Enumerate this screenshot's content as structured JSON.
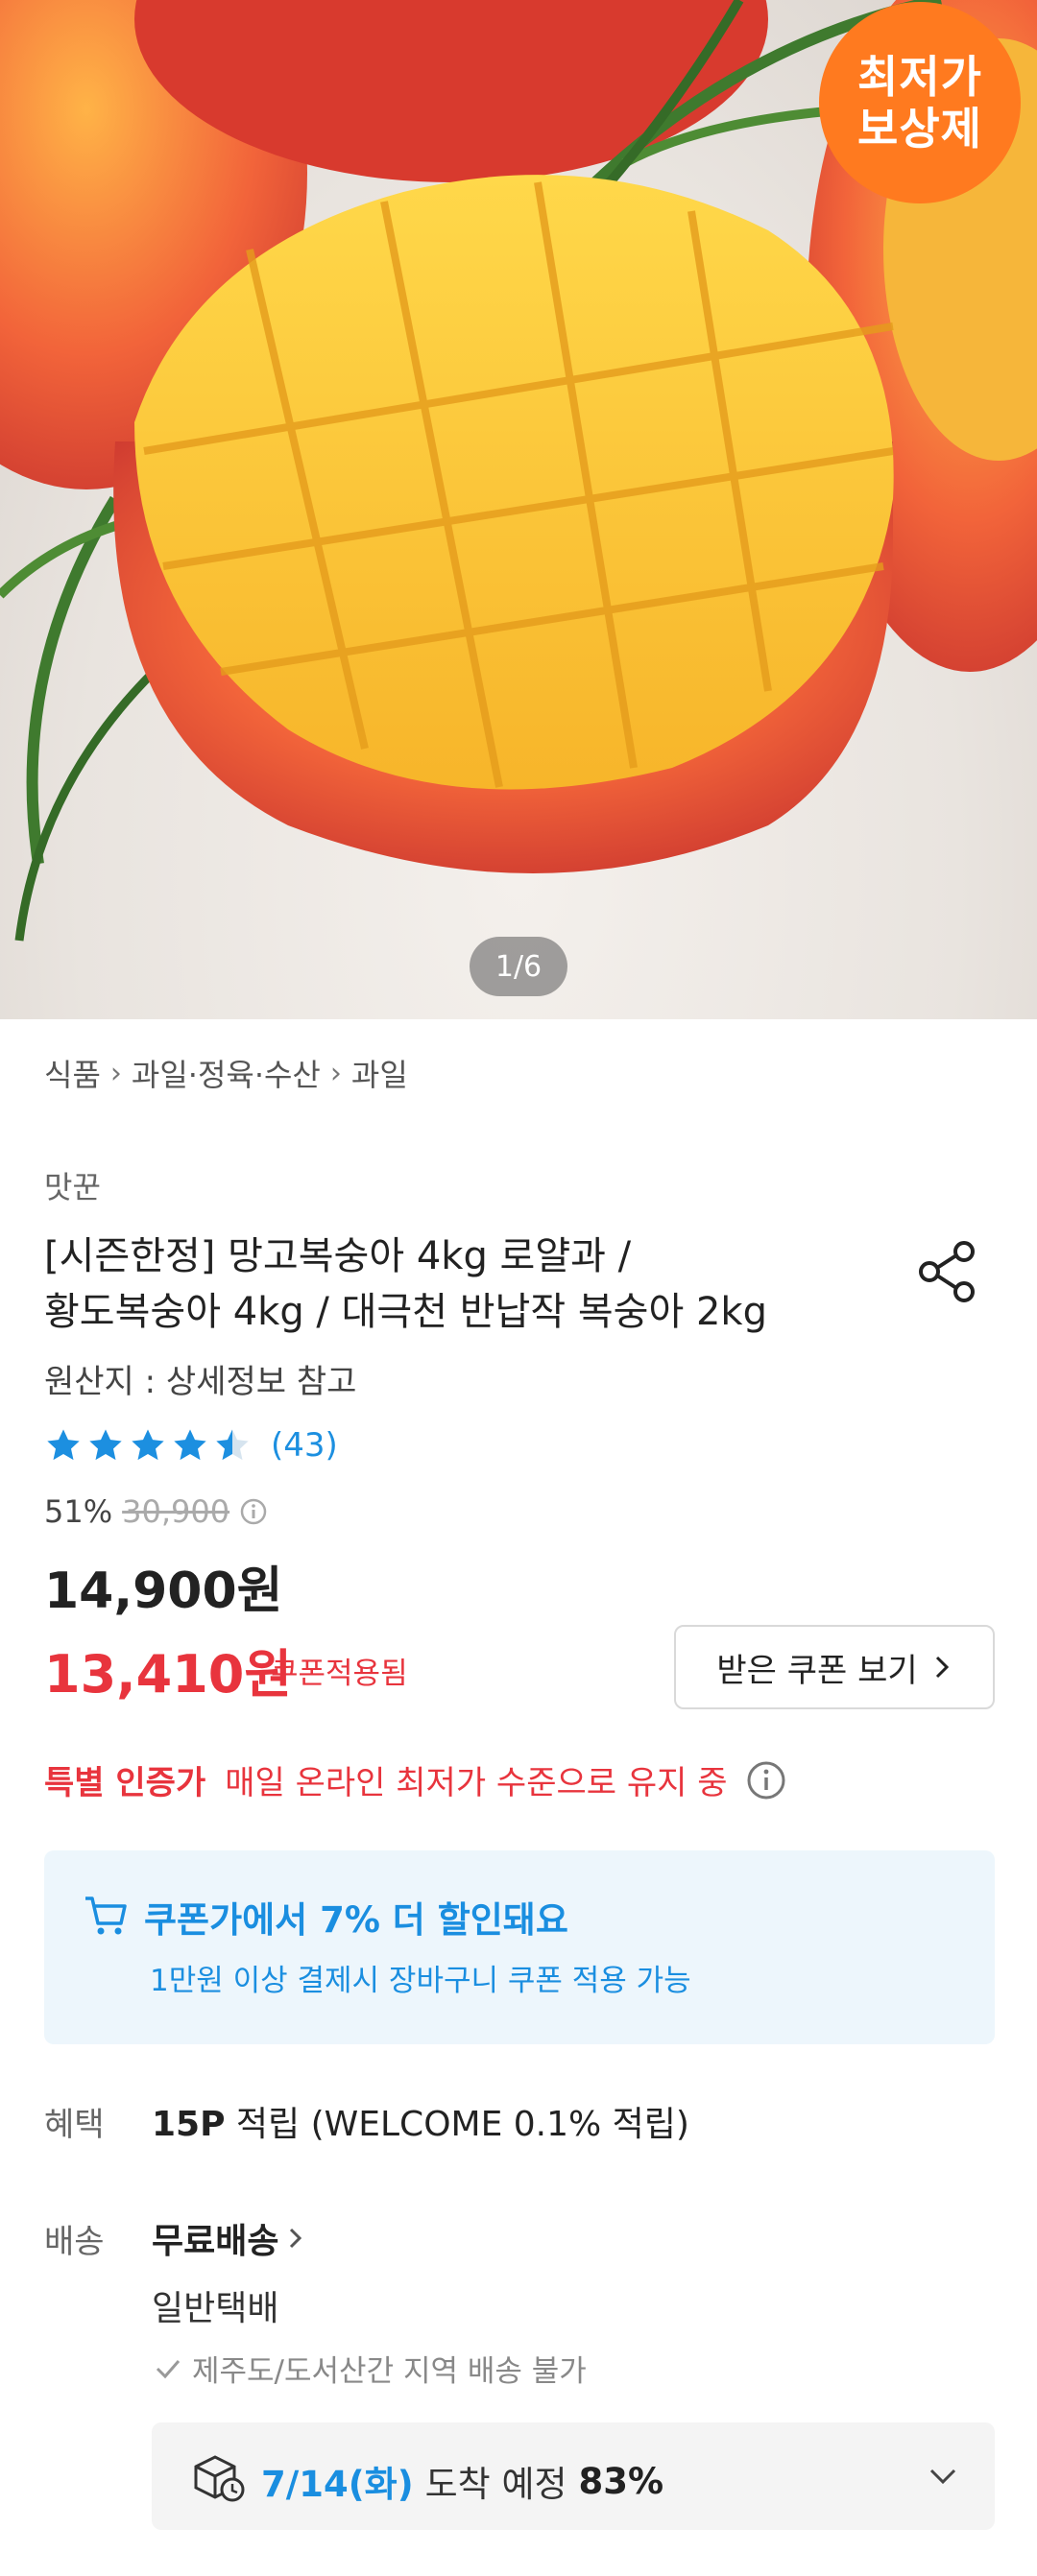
{
  "hero": {
    "badge_line1": "최저가",
    "badge_line2": "보상제",
    "counter": "1/6"
  },
  "breadcrumb": [
    "식품",
    "과일·정육·수산",
    "과일"
  ],
  "product": {
    "brand": "맛꾼",
    "title_line1": "[시즌한정] 망고복숭아 4kg 로얄과 /",
    "title_line2": "황도복숭아 4kg / 대극천 반납작 복숭아 2kg",
    "origin": "원산지 : 상세정보 참고",
    "rating": 4.5,
    "reviews": "(43)",
    "discount_pct": "51%",
    "original_price": "30,900",
    "price": "14,900원",
    "coupon_price": "13,410원",
    "coupon_applied": "쿠폰적용됨",
    "coupon_button": "받은 쿠폰 보기"
  },
  "certified": {
    "label": "특별 인증가",
    "text": "매일 온라인 최저가 수준으로 유지 중"
  },
  "promo": {
    "headline": "쿠폰가에서 7% 더 할인돼요",
    "sub": "1만원 이상 결제시 장바구니 쿠폰 적용 가능"
  },
  "benefit": {
    "label": "혜택",
    "points": "15P",
    "rest": " 적립 (WELCOME 0.1% 적립)"
  },
  "shipping": {
    "label": "배송",
    "value": "무료배송",
    "type": "일반택배",
    "note": "제주도/도서산간 지역 배송 불가",
    "eta_date": "7/14(화)",
    "eta_text": "도착 예정",
    "eta_pct": "83%"
  },
  "colors": {
    "accent_red": "#e8343d",
    "accent_blue": "#1a8ee0",
    "badge_orange": "#ff7a1f"
  }
}
